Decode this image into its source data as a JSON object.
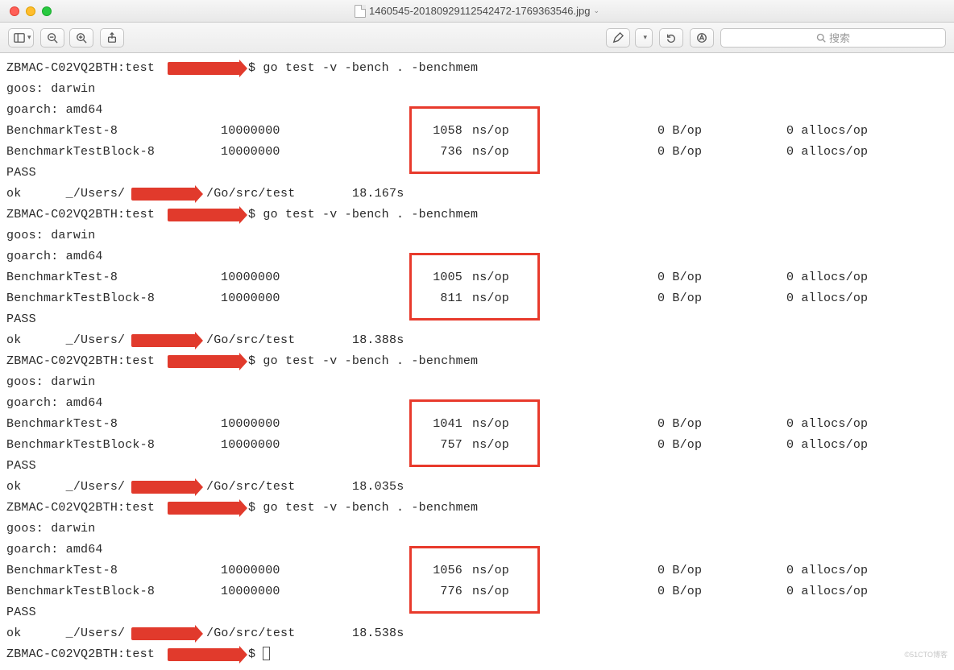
{
  "window": {
    "title": "1460545-20180929112542472-1769363546.jpg",
    "search_placeholder": "搜索"
  },
  "runs": [
    {
      "prompt": "ZBMAC-C02VQ2BTH:test ",
      "command": "$ go test -v -bench . -benchmem",
      "goos": "goos: darwin",
      "goarch": "goarch: amd64",
      "bench": [
        {
          "name": "BenchmarkTest-8",
          "iter": "10000000",
          "ns": "1058",
          "nslabel": "ns/op",
          "bop": "0 B/op",
          "aop": "0 allocs/op"
        },
        {
          "name": "BenchmarkTestBlock-8",
          "iter": "10000000",
          "ns": "736",
          "nslabel": "ns/op",
          "bop": "0 B/op",
          "aop": "0 allocs/op"
        }
      ],
      "pass": "PASS",
      "ok_prefix": "ok      _/Users/",
      "ok_suffix": "/Go/src/test",
      "time": "18.167s"
    },
    {
      "prompt": "ZBMAC-C02VQ2BTH:test ",
      "command": "$ go test -v -bench . -benchmem",
      "goos": "goos: darwin",
      "goarch": "goarch: amd64",
      "bench": [
        {
          "name": "BenchmarkTest-8",
          "iter": "10000000",
          "ns": "1005",
          "nslabel": "ns/op",
          "bop": "0 B/op",
          "aop": "0 allocs/op"
        },
        {
          "name": "BenchmarkTestBlock-8",
          "iter": "10000000",
          "ns": "811",
          "nslabel": "ns/op",
          "bop": "0 B/op",
          "aop": "0 allocs/op"
        }
      ],
      "pass": "PASS",
      "ok_prefix": "ok      _/Users/",
      "ok_suffix": "/Go/src/test",
      "time": "18.388s"
    },
    {
      "prompt": "ZBMAC-C02VQ2BTH:test ",
      "command": "$ go test -v -bench . -benchmem",
      "goos": "goos: darwin",
      "goarch": "goarch: amd64",
      "bench": [
        {
          "name": "BenchmarkTest-8",
          "iter": "10000000",
          "ns": "1041",
          "nslabel": "ns/op",
          "bop": "0 B/op",
          "aop": "0 allocs/op"
        },
        {
          "name": "BenchmarkTestBlock-8",
          "iter": "10000000",
          "ns": "757",
          "nslabel": "ns/op",
          "bop": "0 B/op",
          "aop": "0 allocs/op"
        }
      ],
      "pass": "PASS",
      "ok_prefix": "ok      _/Users/",
      "ok_suffix": "/Go/src/test",
      "time": "18.035s"
    },
    {
      "prompt": "ZBMAC-C02VQ2BTH:test ",
      "command": "$ go test -v -bench . -benchmem",
      "goos": "goos: darwin",
      "goarch": "goarch: amd64",
      "bench": [
        {
          "name": "BenchmarkTest-8",
          "iter": "10000000",
          "ns": "1056",
          "nslabel": "ns/op",
          "bop": "0 B/op",
          "aop": "0 allocs/op"
        },
        {
          "name": "BenchmarkTestBlock-8",
          "iter": "10000000",
          "ns": "776",
          "nslabel": "ns/op",
          "bop": "0 B/op",
          "aop": "0 allocs/op"
        }
      ],
      "pass": "PASS",
      "ok_prefix": "ok      _/Users/",
      "ok_suffix": "/Go/src/test",
      "time": "18.538s"
    }
  ],
  "final_prompt": "ZBMAC-C02VQ2BTH:test ",
  "final_dollar": "$ "
}
